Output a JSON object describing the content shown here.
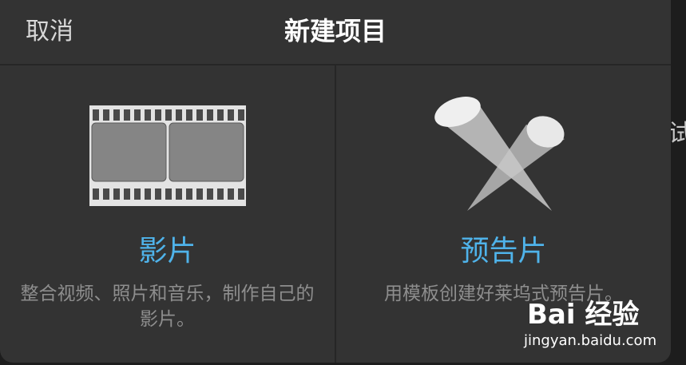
{
  "header": {
    "cancel_label": "取消",
    "title": "新建项目"
  },
  "options": [
    {
      "icon": "film-strip-icon",
      "label": "影片",
      "description": "整合视频、照片和音乐，制作自己的影片。"
    },
    {
      "icon": "spotlights-icon",
      "label": "预告片",
      "description": "用模板创建好莱坞式预告片。"
    }
  ],
  "background": {
    "peek_text": "试"
  },
  "watermark": {
    "logo_text": "Bai 经验",
    "url": "jingyan.baidu.com"
  },
  "colors": {
    "sheet_background": "#333333",
    "accent": "#4fb3ea",
    "title_text": "#ffffff",
    "secondary_text": "#8e8e8e"
  }
}
